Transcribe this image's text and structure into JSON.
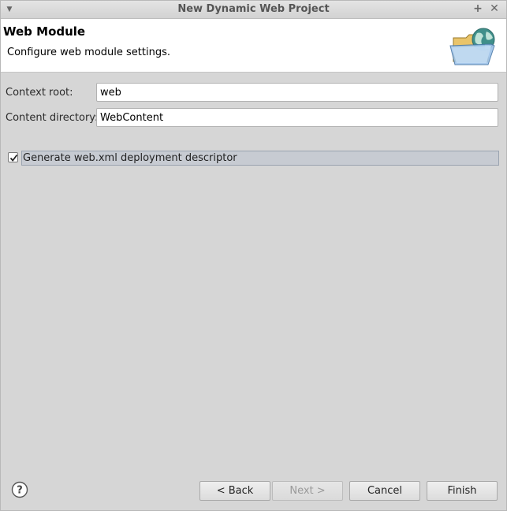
{
  "window": {
    "title": "New Dynamic Web Project",
    "menu_icon": "chevron-down-icon",
    "maximize_icon": "plus-icon",
    "close_icon": "close-icon"
  },
  "banner": {
    "heading": "Web Module",
    "subheading": "Configure web module settings.",
    "icon": "globe-folder-icon"
  },
  "form": {
    "context_root": {
      "label": "Context root:",
      "value": "web"
    },
    "content_directory": {
      "label": "Content directory:",
      "value": "WebContent"
    },
    "generate_descriptor": {
      "label": "Generate web.xml deployment descriptor",
      "checked": true
    }
  },
  "buttons": {
    "help_icon": "help-icon",
    "back": "< Back",
    "next": "Next >",
    "cancel": "Cancel",
    "finish": "Finish"
  },
  "colors": {
    "dialog_bg": "#d6d6d6",
    "banner_bg": "#ffffff",
    "selection_bg": "#c7cbd2"
  }
}
